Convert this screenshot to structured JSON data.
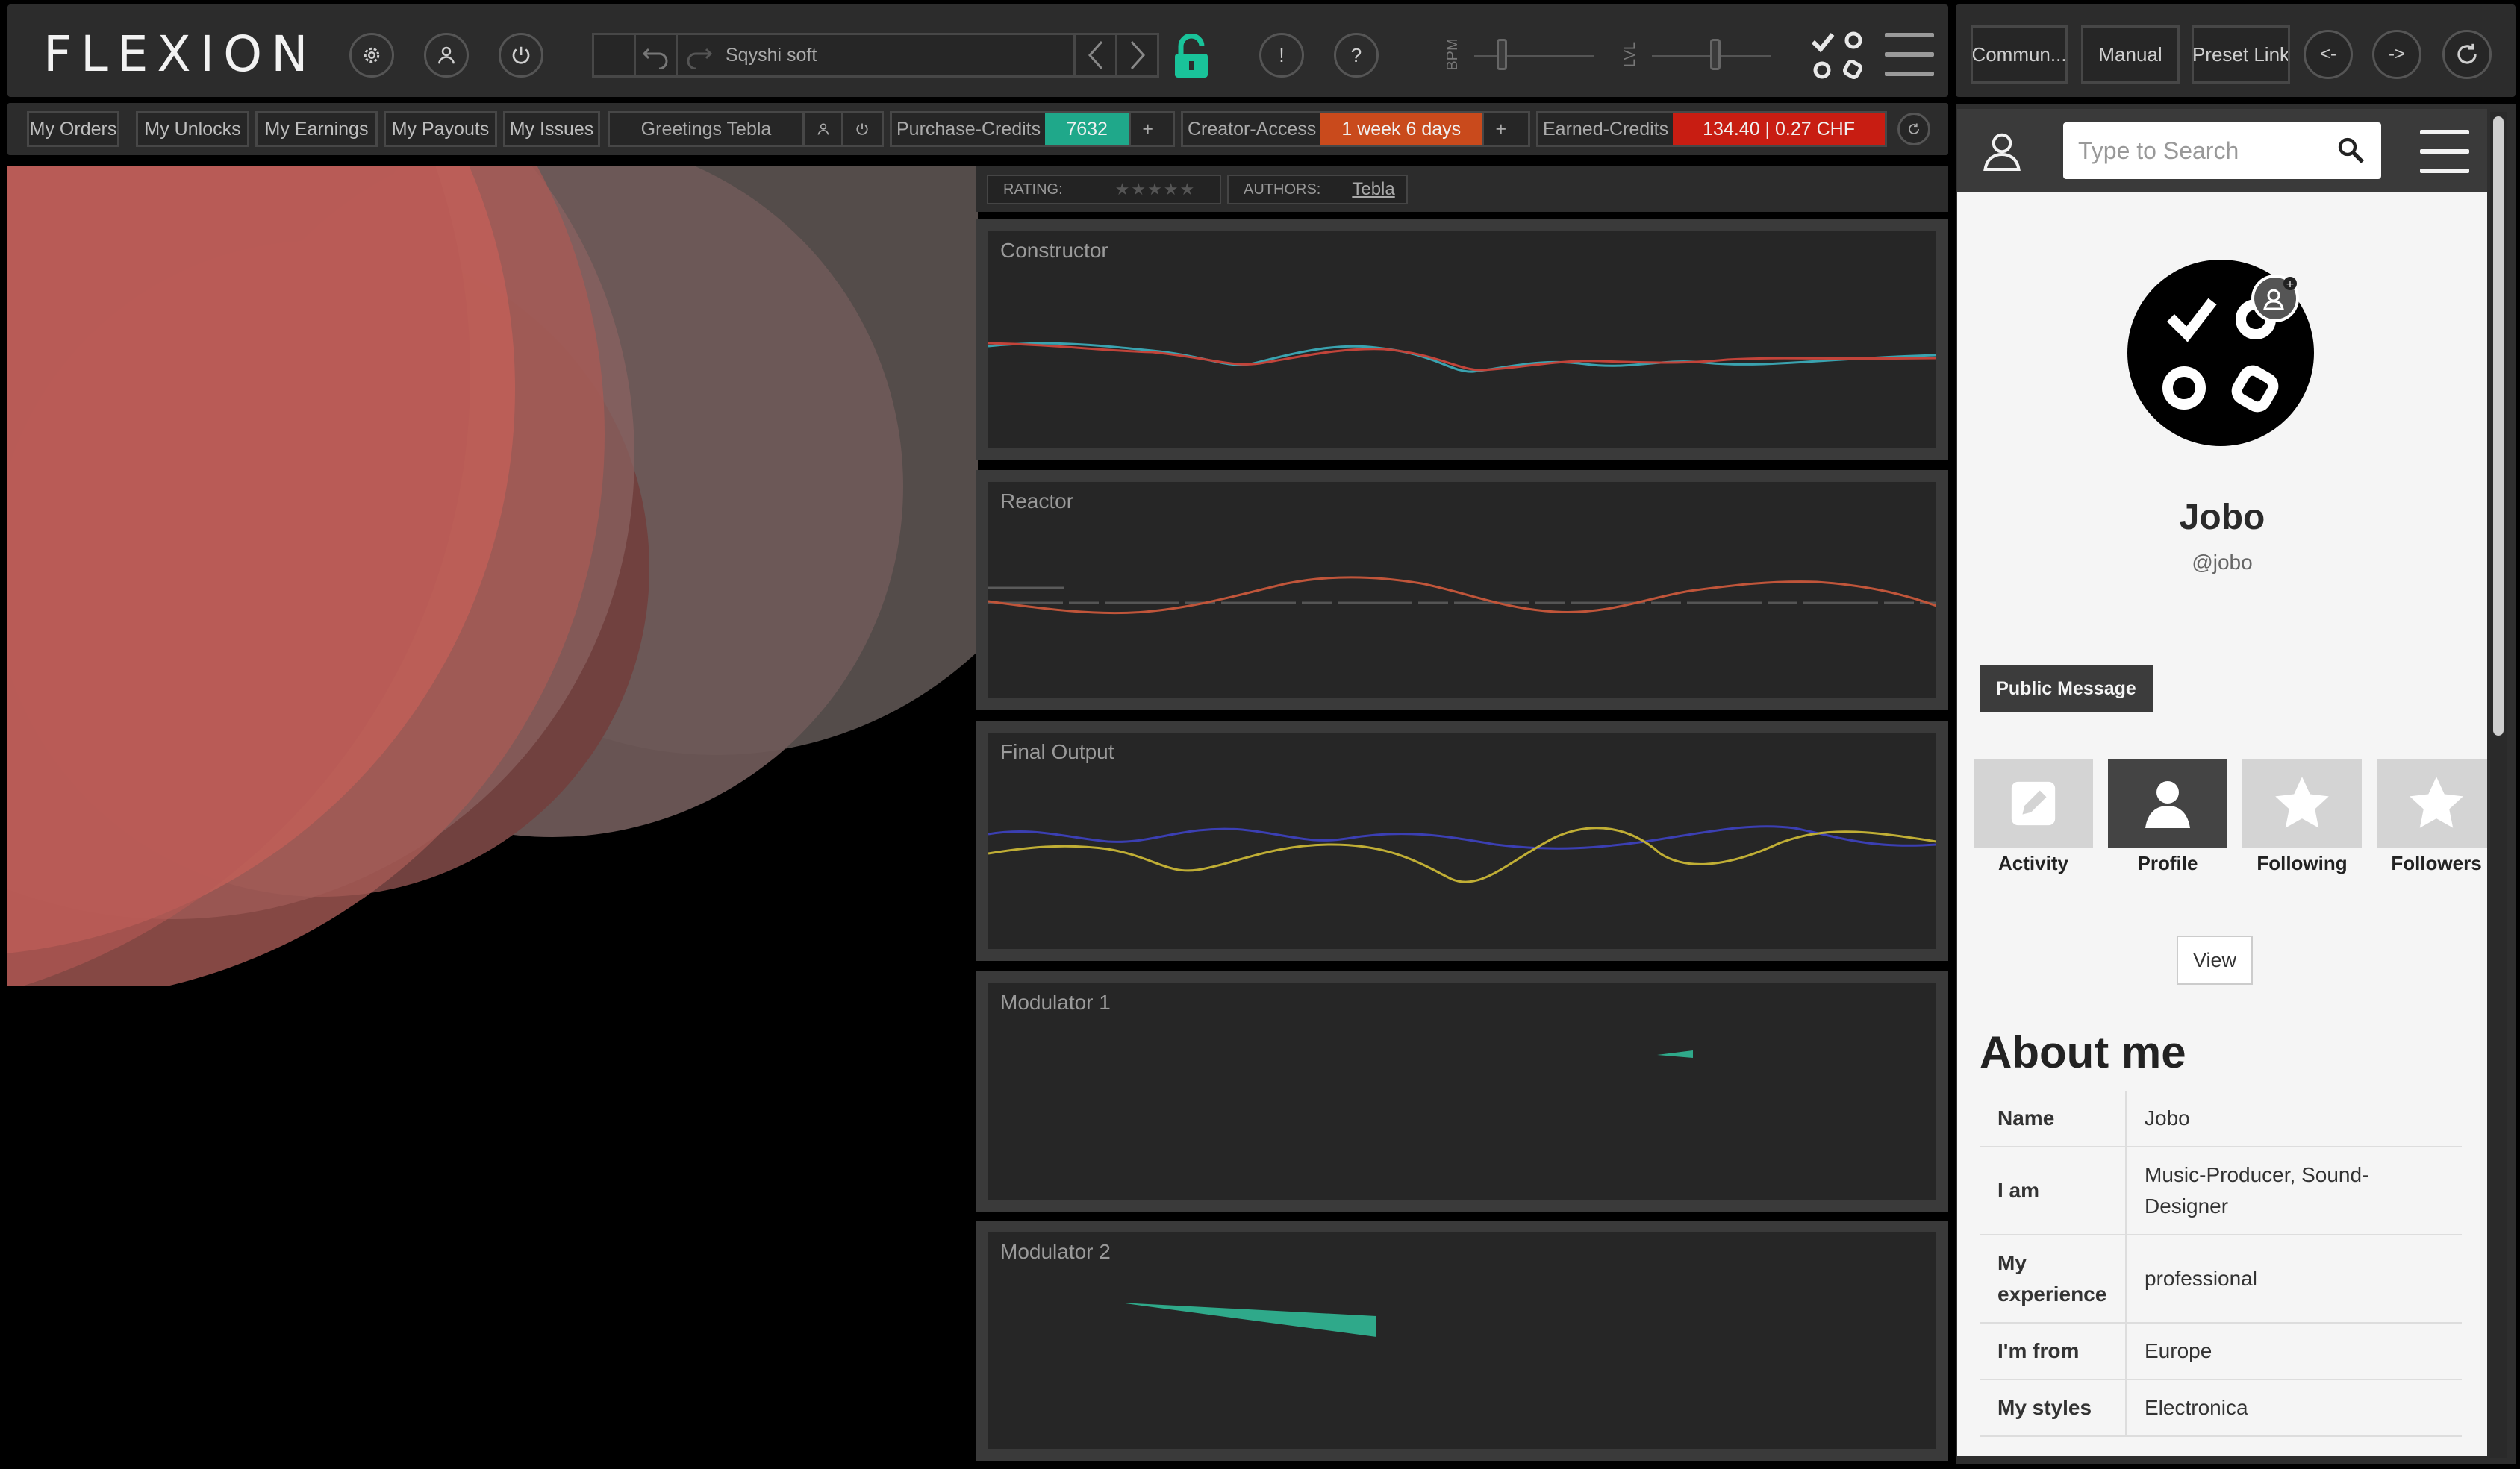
{
  "app": {
    "logo": "FLEXION",
    "preset_name": "Sqyshi soft",
    "bpm_label": "BPM",
    "lvl_label": "LVL",
    "alert_symbol": "!",
    "help_symbol": "?"
  },
  "menu": {
    "items": [
      "My Orders",
      "My Unlocks",
      "My Earnings",
      "My Payouts",
      "My Issues"
    ],
    "greeting": "Greetings Tebla",
    "purchase_label": "Purchase-Credits",
    "purchase_value": "7632",
    "creator_label": "Creator-Access",
    "creator_value": "1 week 6 days",
    "earned_label": "Earned-Credits",
    "earned_value": "134.40 | 0.27 CHF",
    "plus": "+"
  },
  "rating": {
    "rating_label": "RATING:",
    "stars": "★★★★★",
    "authors_label": "AUTHORS:",
    "author": "Tebla"
  },
  "panels": {
    "p1": "Constructor",
    "p2": "Reactor",
    "p3": "Final Output",
    "p4": "Modulator 1",
    "p5": "Modulator 2"
  },
  "sidebar": {
    "top_buttons": [
      "Commun...",
      "Manual",
      "Preset Link"
    ],
    "back": "<-",
    "forward": "->",
    "search_placeholder": "Type to Search",
    "name": "Jobo",
    "handle": "@jobo",
    "public_message": "Public Message",
    "tabs": [
      "Activity",
      "Profile",
      "Following",
      "Followers"
    ],
    "view": "View",
    "about_title": "About me",
    "about": [
      {
        "k": "Name",
        "v": "Jobo"
      },
      {
        "k": "I am",
        "v": "Music-Producer, Sound-Designer"
      },
      {
        "k": "My experience",
        "v": "professional"
      },
      {
        "k": "I'm from",
        "v": "Europe"
      },
      {
        "k": "My styles",
        "v": "Electronica"
      }
    ]
  },
  "colors": {
    "purchase": "#1fa88a",
    "creator": "#c94a1c",
    "earned": "#c81d12",
    "lock": "#19c39a",
    "teal": "#2fa98a",
    "red_line": "#c2443a",
    "cyan_line": "#3aa3b0",
    "orange_line": "#c0553a",
    "blue_line": "#3b3fb3",
    "yellow_line": "#c0ae35"
  }
}
